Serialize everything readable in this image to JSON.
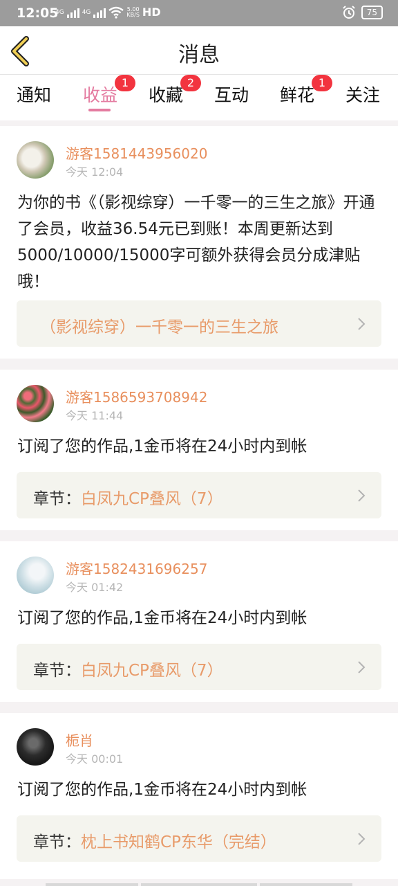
{
  "status_bar": {
    "time": "12:05",
    "net1": "4G",
    "net2": "4G",
    "speed_value": "5.00",
    "speed_unit": "KB/S",
    "hd": "HD",
    "battery": "75"
  },
  "header": {
    "title": "消息"
  },
  "tabs": [
    {
      "label": "通知",
      "badge": ""
    },
    {
      "label": "收益",
      "badge": "1"
    },
    {
      "label": "收藏",
      "badge": "2"
    },
    {
      "label": "互动",
      "badge": ""
    },
    {
      "label": "鲜花",
      "badge": "1"
    },
    {
      "label": "关注",
      "badge": ""
    }
  ],
  "messages": [
    {
      "user": "游客1581443956020",
      "time": "今天 12:04",
      "text": "为你的书《（影视综穿）一千零一的三生之旅》开通了会员，收益36.54元已到账！本周更新达到5000/10000/15000字可额外获得会员分成津贴哦！",
      "link_label": "",
      "link_value": "（影视综穿）一千零一的三生之旅"
    },
    {
      "user": "游客1586593708942",
      "time": "今天 11:44",
      "text": "订阅了您的作品,1金币将在24小时内到帐",
      "link_label": "章节：",
      "link_value": "白凤九CP叠风（7）"
    },
    {
      "user": "游客1582431696257",
      "time": "今天 01:42",
      "text": "订阅了您的作品,1金币将在24小时内到帐",
      "link_label": "章节：",
      "link_value": "白凤九CP叠风（7）"
    },
    {
      "user": "栀肖",
      "time": "今天 00:01",
      "text": "订阅了您的作品,1金币将在24小时内到帐",
      "link_label": "章节：",
      "link_value": "枕上书知鹤CP东华（完结）"
    }
  ],
  "colors": {
    "accent_pink": "#e47ba0",
    "username_orange": "#e88f5d",
    "badge_red": "#f2343f",
    "back_arrow": "#d9a834"
  }
}
